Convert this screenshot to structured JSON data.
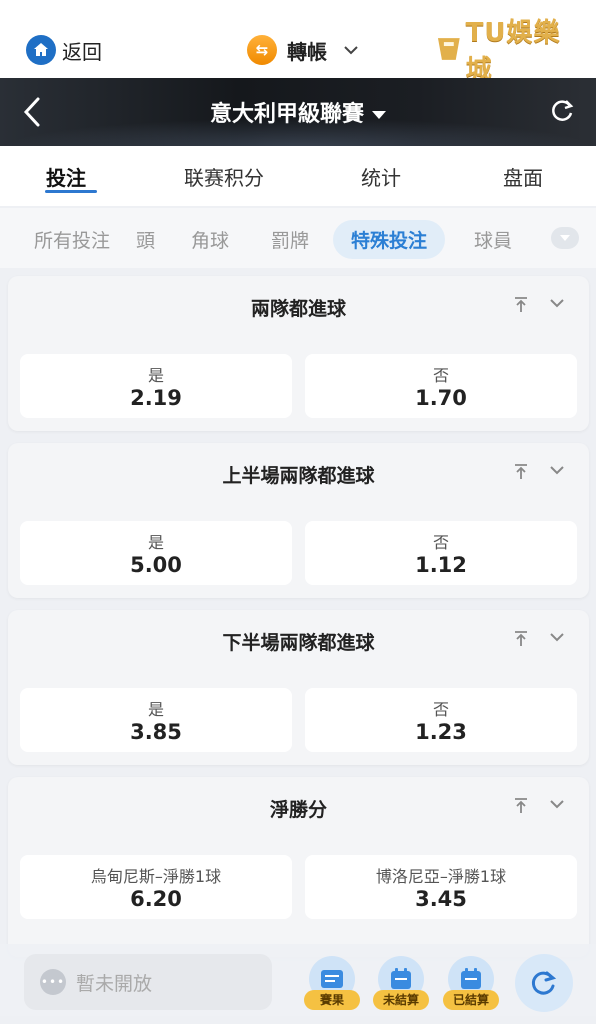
{
  "topbar": {
    "back_label": "返回",
    "transfer_label": "轉帳",
    "logo_text": "TU娛樂城"
  },
  "header": {
    "title": "意大利甲級聯賽"
  },
  "main_tabs": [
    {
      "label": "投注",
      "active": true
    },
    {
      "label": "联赛积分",
      "active": false
    },
    {
      "label": "统计",
      "active": false
    },
    {
      "label": "盘面",
      "active": false
    }
  ],
  "sub_tabs": [
    {
      "label": "所有投注",
      "active": false
    },
    {
      "label": "頭",
      "active": false
    },
    {
      "label": "角球",
      "active": false
    },
    {
      "label": "罰牌",
      "active": false
    },
    {
      "label": "特殊投注",
      "active": true
    },
    {
      "label": "球員",
      "active": false
    }
  ],
  "markets": [
    {
      "title": "兩隊都進球",
      "selections": [
        {
          "label": "是",
          "odds": "2.19"
        },
        {
          "label": "否",
          "odds": "1.70"
        }
      ]
    },
    {
      "title": "上半場兩隊都進球",
      "selections": [
        {
          "label": "是",
          "odds": "5.00"
        },
        {
          "label": "否",
          "odds": "1.12"
        }
      ]
    },
    {
      "title": "下半場兩隊都進球",
      "selections": [
        {
          "label": "是",
          "odds": "3.85"
        },
        {
          "label": "否",
          "odds": "1.23"
        }
      ]
    },
    {
      "title": "淨勝分",
      "selections": [
        {
          "label": "烏甸尼斯–淨勝1球",
          "odds": "6.20"
        },
        {
          "label": "博洛尼亞–淨勝1球",
          "odds": "3.45"
        }
      ]
    }
  ],
  "bottom": {
    "chat_placeholder": "暫未開放",
    "buttons": [
      {
        "label": "賽果",
        "icon": "results-icon"
      },
      {
        "label": "未結算",
        "icon": "calendar-icon"
      },
      {
        "label": "已結算",
        "icon": "calendar-icon"
      }
    ],
    "refresh_icon": "refresh-icon"
  },
  "colors": {
    "accent": "#2d78d0",
    "active_subtab_bg": "#e1edf8",
    "badge": "#f5c142",
    "logo_gold": "#e2b04b"
  }
}
